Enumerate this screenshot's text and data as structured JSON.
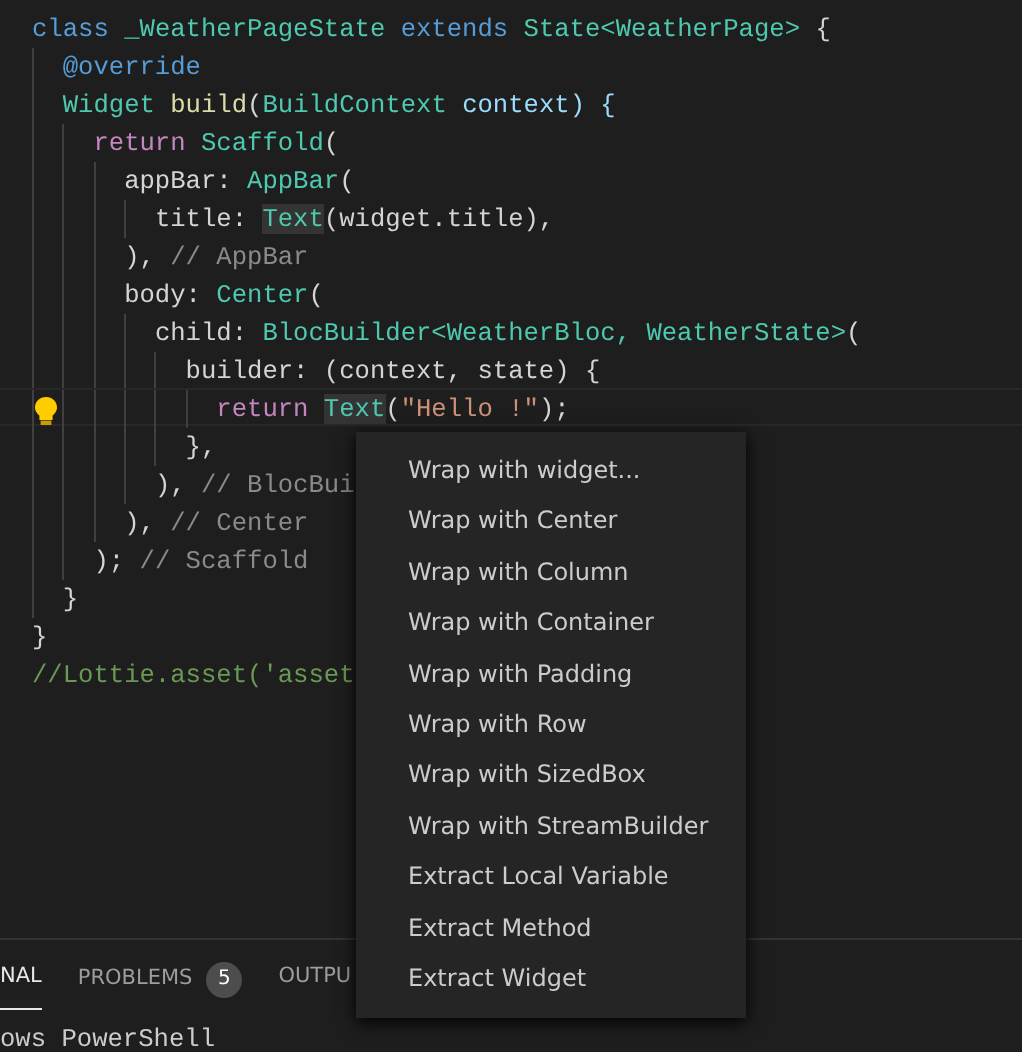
{
  "editor": {
    "lines": [
      {
        "current": false,
        "tokens": [
          {
            "text": "class",
            "kind": "keyword"
          },
          {
            "text": " _WeatherPageState ",
            "kind": "type"
          },
          {
            "text": "extends",
            "kind": "keyword"
          },
          {
            "text": " State<WeatherPage> ",
            "kind": "type"
          },
          {
            "text": "{",
            "kind": "punct"
          }
        ]
      },
      {
        "current": false,
        "tokens": [
          {
            "text": "  @override",
            "kind": "keyword"
          }
        ]
      },
      {
        "current": false,
        "tokens": [
          {
            "text": "  Widget ",
            "kind": "type"
          },
          {
            "text": "build",
            "kind": "function"
          },
          {
            "text": "(",
            "kind": "punct"
          },
          {
            "text": "BuildContext ",
            "kind": "type"
          },
          {
            "text": "context) {",
            "kind": "param"
          }
        ]
      },
      {
        "current": false,
        "tokens": [
          {
            "text": "    return ",
            "kind": "control"
          },
          {
            "text": "Scaffold",
            "kind": "type"
          },
          {
            "text": "(",
            "kind": "punct"
          }
        ]
      },
      {
        "current": false,
        "tokens": [
          {
            "text": "      appBar: ",
            "kind": "punct"
          },
          {
            "text": "AppBar",
            "kind": "type"
          },
          {
            "text": "(",
            "kind": "punct"
          }
        ]
      },
      {
        "current": false,
        "tokens": [
          {
            "text": "        title: ",
            "kind": "punct"
          },
          {
            "text": "Text",
            "kind": "type-hl"
          },
          {
            "text": "(widget.title),",
            "kind": "punct"
          }
        ]
      },
      {
        "current": false,
        "tokens": [
          {
            "text": "      ), ",
            "kind": "punct"
          },
          {
            "text": "// AppBar",
            "kind": "label"
          }
        ]
      },
      {
        "current": false,
        "tokens": [
          {
            "text": "      body: ",
            "kind": "punct"
          },
          {
            "text": "Center",
            "kind": "type"
          },
          {
            "text": "(",
            "kind": "punct"
          }
        ]
      },
      {
        "current": false,
        "tokens": [
          {
            "text": "        child: ",
            "kind": "punct"
          },
          {
            "text": "BlocBuilder<WeatherBloc, WeatherState>",
            "kind": "type"
          },
          {
            "text": "(",
            "kind": "punct"
          }
        ]
      },
      {
        "current": false,
        "tokens": [
          {
            "text": "          builder: (context, state) {",
            "kind": "punct"
          }
        ]
      },
      {
        "current": true,
        "tokens": [
          {
            "text": "            return ",
            "kind": "control"
          },
          {
            "text": "Text",
            "kind": "type-hl"
          },
          {
            "text": "(",
            "kind": "punct"
          },
          {
            "text": "\"Hello !\"",
            "kind": "string"
          },
          {
            "text": ");",
            "kind": "punct"
          }
        ]
      },
      {
        "current": false,
        "tokens": [
          {
            "text": "          },",
            "kind": "punct"
          }
        ]
      },
      {
        "current": false,
        "tokens": [
          {
            "text": "        ), ",
            "kind": "punct"
          },
          {
            "text": "// BlocBui",
            "kind": "label"
          }
        ]
      },
      {
        "current": false,
        "tokens": [
          {
            "text": "      ), ",
            "kind": "punct"
          },
          {
            "text": "// Center",
            "kind": "label"
          }
        ]
      },
      {
        "current": false,
        "tokens": [
          {
            "text": "    ); ",
            "kind": "punct"
          },
          {
            "text": "// Scaffold",
            "kind": "label"
          }
        ]
      },
      {
        "current": false,
        "tokens": [
          {
            "text": "  }",
            "kind": "punct"
          }
        ]
      },
      {
        "current": false,
        "tokens": [
          {
            "text": "}",
            "kind": "punct"
          }
        ]
      },
      {
        "current": false,
        "tokens": [
          {
            "text": "//Lottie.asset('asset",
            "kind": "comment"
          }
        ]
      }
    ]
  },
  "context_menu": {
    "items": [
      "Wrap with widget...",
      "Wrap with Center",
      "Wrap with Column",
      "Wrap with Container",
      "Wrap with Padding",
      "Wrap with Row",
      "Wrap with SizedBox",
      "Wrap with StreamBuilder",
      "Extract Local Variable",
      "Extract Method",
      "Extract Widget"
    ]
  },
  "panel": {
    "tabs": [
      {
        "label": "NAL",
        "selected": true
      },
      {
        "label": "PROBLEMS",
        "selected": false,
        "badge": "5"
      },
      {
        "label": "OUTPU",
        "selected": false
      }
    ],
    "terminal_text": "ows PowerShell"
  }
}
